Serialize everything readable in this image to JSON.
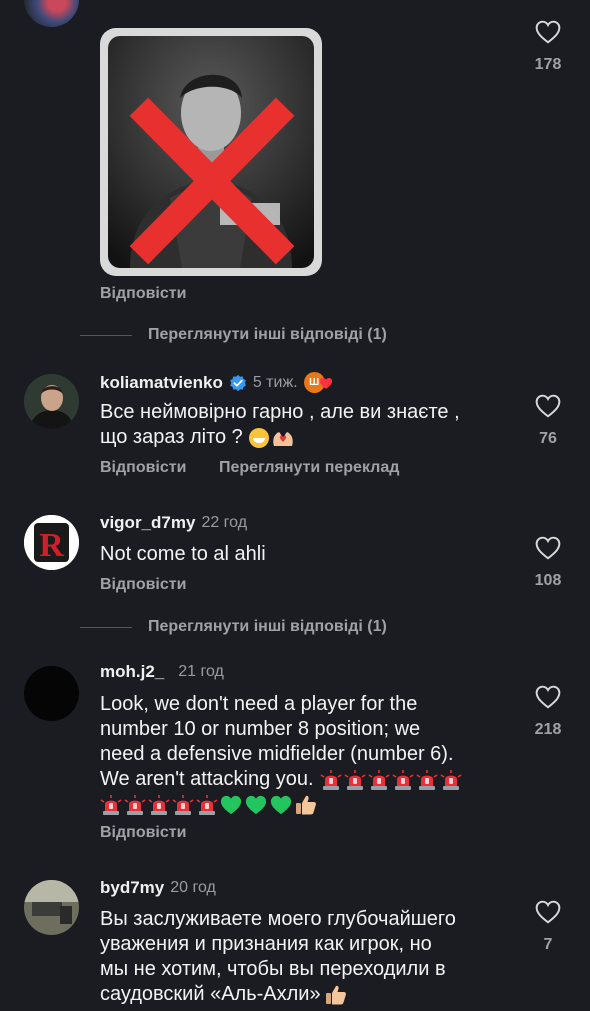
{
  "comments": [
    {
      "id": "top",
      "likes": "178",
      "action_reply": "Відповісти"
    },
    {
      "id": "koliamatvienko",
      "username": "koliamatvienko",
      "time": "5 тиж.",
      "text_line1": "Все неймовірно гарно , але ви знаєте ,",
      "text_line2": "що зараз літо ?",
      "likes": "76",
      "action_reply": "Відповісти",
      "action_translate": "Переглянути переклад"
    },
    {
      "id": "vigor",
      "username": "vigor_d7my",
      "time": "22 год",
      "text": "Not come to al ahli",
      "likes": "108",
      "action_reply": "Відповісти"
    },
    {
      "id": "moh",
      "username": "moh.j2_",
      "time": "21 год",
      "text_lines": [
        "Look, we don't need a player for the",
        "number 10 or number 8 position; we",
        "need a defensive midfielder (number 6).",
        "We aren't attacking you."
      ],
      "likes": "218",
      "action_reply": "Відповісти"
    },
    {
      "id": "byd",
      "username": "byd7my",
      "time": "20 год",
      "text_lines": [
        "Вы заслуживаете моего глубочайшего",
        "уважения и признания как игрок, но",
        "мы не хотим, чтобы вы переходили в",
        "саудовский «Аль-Ахли»"
      ],
      "likes": "7"
    }
  ],
  "more_replies_1": "Переглянути інші відповіді (1)",
  "more_replies_2": "Переглянути інші відповіді (1)",
  "icons": {
    "heart": "heart-icon",
    "verified": "verified-badge-icon",
    "siren": "police-light-emoji",
    "green_heart": "green-heart-emoji",
    "thumbs_up": "thumbs-up-emoji"
  },
  "colors": {
    "background": "#1b1c21",
    "verified": "#3897f0",
    "muted": "#a0a1a7"
  }
}
